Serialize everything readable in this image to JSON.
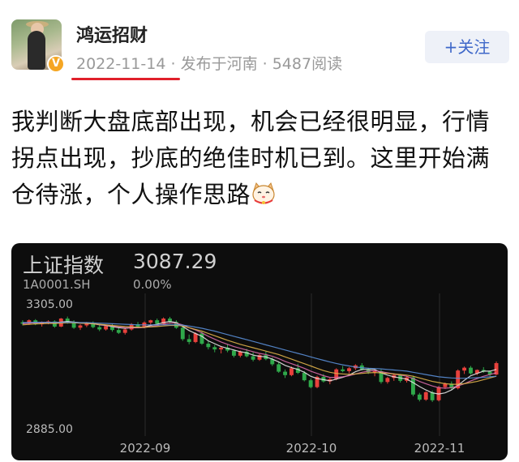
{
  "author": {
    "name": "鸿运招财",
    "verified_badge_icon": "verified-v-icon",
    "date": "2022-11-14",
    "separator": "·",
    "location": "发布于河南",
    "views": "5487阅读"
  },
  "follow_button": {
    "label": "+关注",
    "color": "#3f68c9"
  },
  "post": {
    "text": "我判断大盘底部出现，机会已经很明显，行情拐点出现，抄底的绝佳时机已到。这里开始满仓待涨，个人操作思路",
    "emoji_icon": "lucky-cat-emoji-icon"
  },
  "stock_card": {
    "name": "上证指数",
    "price": "3087.29",
    "code": "1A0001.SH",
    "change": "0.00%",
    "background": "#0d0d0d"
  },
  "chart_data": {
    "type": "candlestick",
    "y_top_label": "3305.00",
    "y_bottom_label": "2885.00",
    "ylim": [
      2885,
      3305
    ],
    "x_labels": [
      "2022-09",
      "2022-10",
      "2022-11"
    ],
    "up_color": "#e8413c",
    "down_color": "#2fa84a",
    "candles": [
      [
        3255,
        3262,
        3244,
        3250
      ],
      [
        3250,
        3265,
        3246,
        3262
      ],
      [
        3262,
        3266,
        3245,
        3248
      ],
      [
        3248,
        3258,
        3240,
        3255
      ],
      [
        3255,
        3262,
        3248,
        3258
      ],
      [
        3258,
        3262,
        3236,
        3240
      ],
      [
        3240,
        3270,
        3238,
        3268
      ],
      [
        3268,
        3275,
        3250,
        3254
      ],
      [
        3254,
        3262,
        3232,
        3236
      ],
      [
        3236,
        3248,
        3228,
        3244
      ],
      [
        3244,
        3256,
        3238,
        3252
      ],
      [
        3252,
        3258,
        3234,
        3238
      ],
      [
        3238,
        3244,
        3224,
        3230
      ],
      [
        3230,
        3246,
        3226,
        3242
      ],
      [
        3242,
        3250,
        3222,
        3228
      ],
      [
        3228,
        3240,
        3214,
        3218
      ],
      [
        3218,
        3234,
        3212,
        3230
      ],
      [
        3230,
        3252,
        3226,
        3248
      ],
      [
        3248,
        3256,
        3236,
        3240
      ],
      [
        3240,
        3258,
        3234,
        3254
      ],
      [
        3254,
        3264,
        3246,
        3262
      ],
      [
        3262,
        3268,
        3248,
        3250
      ],
      [
        3250,
        3272,
        3246,
        3268
      ],
      [
        3268,
        3274,
        3250,
        3256
      ],
      [
        3256,
        3262,
        3232,
        3236
      ],
      [
        3236,
        3242,
        3190,
        3196
      ],
      [
        3196,
        3212,
        3178,
        3186
      ],
      [
        3186,
        3220,
        3182,
        3216
      ],
      [
        3216,
        3222,
        3176,
        3180
      ],
      [
        3180,
        3190,
        3160,
        3168
      ],
      [
        3168,
        3176,
        3150,
        3160
      ],
      [
        3160,
        3172,
        3146,
        3166
      ],
      [
        3166,
        3178,
        3150,
        3156
      ],
      [
        3156,
        3160,
        3132,
        3138
      ],
      [
        3138,
        3156,
        3132,
        3152
      ],
      [
        3152,
        3162,
        3132,
        3136
      ],
      [
        3136,
        3150,
        3118,
        3124
      ],
      [
        3124,
        3144,
        3120,
        3140
      ],
      [
        3140,
        3152,
        3122,
        3126
      ],
      [
        3126,
        3132,
        3102,
        3108
      ],
      [
        3108,
        3116,
        3078,
        3082
      ],
      [
        3082,
        3090,
        3060,
        3070
      ],
      [
        3070,
        3100,
        3066,
        3094
      ],
      [
        3094,
        3110,
        3074,
        3078
      ],
      [
        3078,
        3084,
        3048,
        3052
      ],
      [
        3052,
        3058,
        3024,
        3028
      ],
      [
        3028,
        3068,
        3024,
        3064
      ],
      [
        3064,
        3074,
        3044,
        3048
      ],
      [
        3048,
        3060,
        3038,
        3056
      ],
      [
        3056,
        3094,
        3052,
        3090
      ],
      [
        3090,
        3102,
        3080,
        3084
      ],
      [
        3084,
        3098,
        3076,
        3094
      ],
      [
        3094,
        3108,
        3088,
        3104
      ],
      [
        3104,
        3112,
        3086,
        3090
      ],
      [
        3090,
        3096,
        3074,
        3080
      ],
      [
        3080,
        3090,
        3066,
        3084
      ],
      [
        3084,
        3090,
        3040,
        3046
      ],
      [
        3046,
        3064,
        3040,
        3060
      ],
      [
        3060,
        3074,
        3050,
        3070
      ],
      [
        3070,
        3074,
        3044,
        3050
      ],
      [
        3050,
        3066,
        3044,
        3062
      ],
      [
        3062,
        3068,
        2996,
        3002
      ],
      [
        3002,
        3008,
        2978,
        2984
      ],
      [
        2984,
        3014,
        2980,
        3010
      ],
      [
        3010,
        3016,
        2976,
        2982
      ],
      [
        2982,
        3032,
        2978,
        3028
      ],
      [
        3028,
        3044,
        3022,
        3040
      ],
      [
        3040,
        3048,
        3018,
        3024
      ],
      [
        3024,
        3090,
        3020,
        3086
      ],
      [
        3086,
        3100,
        3074,
        3096
      ],
      [
        3096,
        3102,
        3072,
        3076
      ],
      [
        3076,
        3090,
        3070,
        3088
      ],
      [
        3088,
        3098,
        3078,
        3082
      ],
      [
        3082,
        3086,
        3066,
        3072
      ],
      [
        3072,
        3118,
        3070,
        3112
      ]
    ],
    "ma_lines": [
      {
        "color": "#e6e6e6",
        "values": [
          3252,
          3254,
          3254,
          3254,
          3255,
          3252,
          3256,
          3258,
          3256,
          3253,
          3252,
          3250,
          3246,
          3244,
          3240,
          3236,
          3234,
          3236,
          3236,
          3238,
          3244,
          3248,
          3254,
          3258,
          3254,
          3240,
          3226,
          3216,
          3206,
          3190,
          3180,
          3170,
          3164,
          3158,
          3152,
          3148,
          3140,
          3136,
          3134,
          3126,
          3116,
          3104,
          3096,
          3090,
          3080,
          3066,
          3058,
          3054,
          3050,
          3056,
          3062,
          3070,
          3082,
          3090,
          3090,
          3090,
          3078,
          3070,
          3064,
          3060,
          3056,
          3044,
          3030,
          3018,
          3008,
          3004,
          3008,
          3018,
          3034,
          3052,
          3068,
          3076,
          3084,
          3084,
          3090
        ]
      },
      {
        "color": "#d86aa8",
        "values": [
          3250,
          3252,
          3253,
          3254,
          3254,
          3253,
          3254,
          3255,
          3254,
          3252,
          3251,
          3250,
          3247,
          3245,
          3242,
          3239,
          3236,
          3236,
          3236,
          3237,
          3240,
          3243,
          3248,
          3252,
          3252,
          3246,
          3236,
          3228,
          3218,
          3206,
          3196,
          3186,
          3178,
          3170,
          3164,
          3158,
          3152,
          3146,
          3142,
          3136,
          3128,
          3118,
          3110,
          3102,
          3094,
          3084,
          3076,
          3068,
          3062,
          3062,
          3064,
          3068,
          3074,
          3080,
          3084,
          3086,
          3082,
          3078,
          3074,
          3070,
          3066,
          3058,
          3048,
          3040,
          3032,
          3026,
          3024,
          3026,
          3032,
          3040,
          3050,
          3058,
          3066,
          3072,
          3078
        ]
      },
      {
        "color": "#e0b34a",
        "values": [
          3246,
          3248,
          3249,
          3250,
          3251,
          3251,
          3252,
          3253,
          3253,
          3252,
          3251,
          3250,
          3248,
          3246,
          3244,
          3242,
          3240,
          3239,
          3238,
          3238,
          3239,
          3240,
          3242,
          3244,
          3244,
          3242,
          3236,
          3230,
          3224,
          3216,
          3208,
          3200,
          3192,
          3185,
          3178,
          3172,
          3166,
          3160,
          3154,
          3148,
          3142,
          3134,
          3126,
          3118,
          3110,
          3102,
          3094,
          3086,
          3080,
          3076,
          3074,
          3073,
          3074,
          3076,
          3078,
          3079,
          3078,
          3076,
          3074,
          3072,
          3070,
          3066,
          3060,
          3054,
          3048,
          3044,
          3040,
          3038,
          3038,
          3040,
          3044,
          3048,
          3054,
          3060,
          3066
        ]
      },
      {
        "color": "#5a8fd8",
        "values": [
          3254,
          3254,
          3255,
          3255,
          3255,
          3255,
          3255,
          3255,
          3255,
          3254,
          3254,
          3253,
          3252,
          3251,
          3250,
          3249,
          3248,
          3247,
          3246,
          3246,
          3246,
          3246,
          3246,
          3246,
          3246,
          3245,
          3242,
          3238,
          3234,
          3229,
          3224,
          3218,
          3212,
          3206,
          3200,
          3194,
          3188,
          3182,
          3176,
          3170,
          3164,
          3158,
          3152,
          3146,
          3140,
          3134,
          3128,
          3122,
          3116,
          3111,
          3106,
          3102,
          3098,
          3096,
          3094,
          3093,
          3092,
          3090,
          3088,
          3086,
          3084,
          3080,
          3076,
          3072,
          3068,
          3064,
          3062,
          3060,
          3059,
          3059,
          3060,
          3061,
          3062,
          3064,
          3066
        ]
      }
    ]
  }
}
